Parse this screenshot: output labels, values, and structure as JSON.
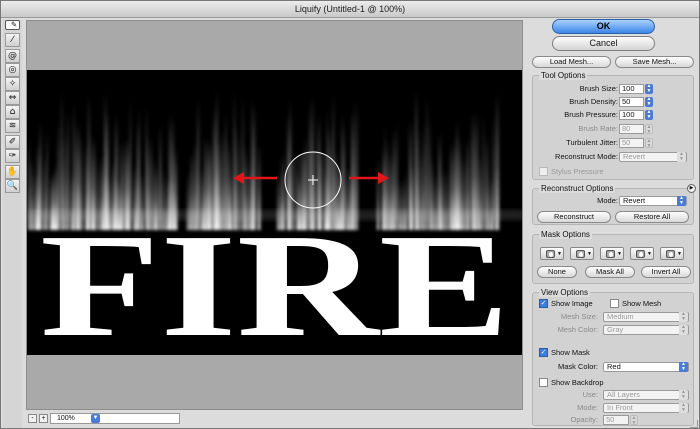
{
  "window": {
    "title": "Liquify (Untitled-1 @ 100%)"
  },
  "tools": [
    {
      "icon": "forward-warp-icon",
      "glyph": "✎"
    },
    {
      "icon": "reconstruct-icon",
      "glyph": "⁄"
    },
    {
      "icon": "twirl-icon",
      "glyph": "@"
    },
    {
      "icon": "pucker-icon",
      "glyph": "◎"
    },
    {
      "icon": "bloat-icon",
      "glyph": "✧"
    },
    {
      "icon": "push-left-icon",
      "glyph": "⇔"
    },
    {
      "icon": "mirror-icon",
      "glyph": "⌂"
    },
    {
      "icon": "turbulence-icon",
      "glyph": "≋"
    },
    {
      "icon": "freeze-mask-icon",
      "glyph": "✐"
    },
    {
      "icon": "thaw-mask-icon",
      "glyph": "✑"
    },
    {
      "icon": "hand-icon",
      "glyph": "✋"
    },
    {
      "icon": "zoom-icon",
      "glyph": "🔍"
    }
  ],
  "canvas": {
    "text": "FIRE",
    "background": "#000000",
    "arrow_color": "#e0161b"
  },
  "status": {
    "zoom_out": "-",
    "zoom_in": "+",
    "zoom": "100%"
  },
  "buttons": {
    "ok": "OK",
    "cancel": "Cancel",
    "load_mesh": "Load Mesh...",
    "save_mesh": "Save Mesh..."
  },
  "tool_options": {
    "title": "Tool Options",
    "brush_size": {
      "label": "Brush Size:",
      "value": "100"
    },
    "brush_density": {
      "label": "Brush Density:",
      "value": "50"
    },
    "brush_pressure": {
      "label": "Brush Pressure:",
      "value": "100"
    },
    "brush_rate": {
      "label": "Brush Rate:",
      "value": "80"
    },
    "turbulent_jitter": {
      "label": "Turbulent Jitter:",
      "value": "50"
    },
    "reconstruct_mode": {
      "label": "Reconstruct Mode:",
      "value": "Revert"
    },
    "stylus_pressure": "Stylus Pressure"
  },
  "reconstruct_options": {
    "title": "Reconstruct Options",
    "mode_label": "Mode:",
    "mode": "Revert",
    "reconstruct": "Reconstruct",
    "restore_all": "Restore All"
  },
  "mask_options": {
    "title": "Mask Options",
    "none": "None",
    "mask_all": "Mask All",
    "invert_all": "Invert All"
  },
  "view_options": {
    "title": "View Options",
    "show_image": "Show Image",
    "show_mesh": "Show Mesh",
    "mesh_size_label": "Mesh Size:",
    "mesh_size": "Medium",
    "mesh_color_label": "Mesh Color:",
    "mesh_color": "Gray",
    "show_mask": "Show Mask",
    "mask_color_label": "Mask Color:",
    "mask_color": "Red",
    "show_backdrop": "Show Backdrop",
    "use_label": "Use:",
    "use": "All Layers",
    "mode_label": "Mode:",
    "mode": "In Front",
    "opacity_label": "Opacity:",
    "opacity": "50"
  }
}
